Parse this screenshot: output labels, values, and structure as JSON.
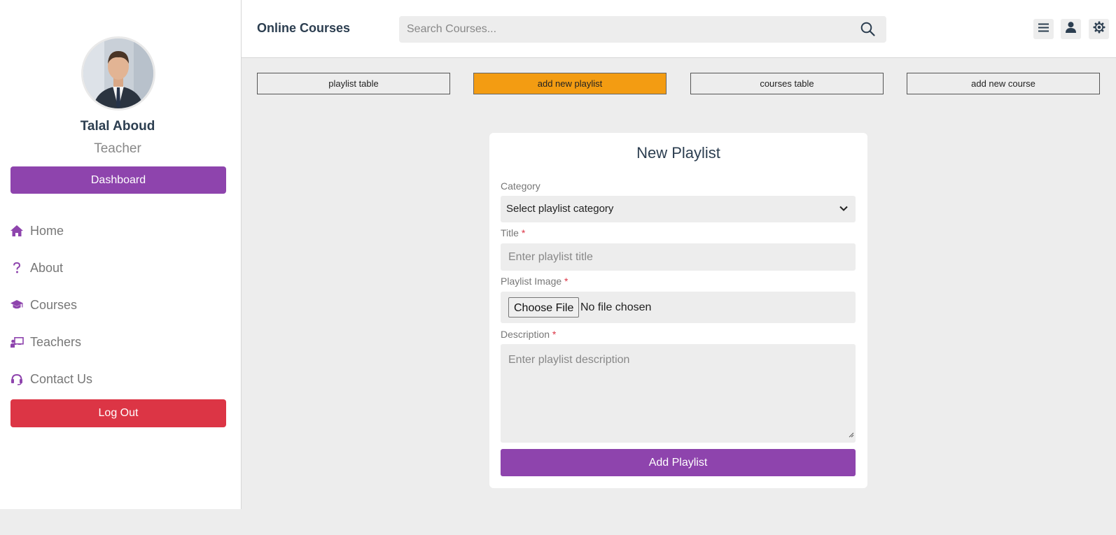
{
  "user": {
    "name": "Talal Aboud",
    "role": "Teacher"
  },
  "sidebar": {
    "dashboard_label": "Dashboard",
    "items": [
      {
        "label": "Home",
        "icon": "home-icon"
      },
      {
        "label": "About",
        "icon": "question-icon"
      },
      {
        "label": "Courses",
        "icon": "graduation-cap-icon"
      },
      {
        "label": "Teachers",
        "icon": "chalkboard-teacher-icon"
      },
      {
        "label": "Contact Us",
        "icon": "headset-icon"
      }
    ],
    "logout_label": "Log Out"
  },
  "header": {
    "brand": "Online Courses",
    "search_placeholder": "Search Courses...",
    "icons": [
      "menu-icon",
      "user-icon",
      "settings-icon"
    ]
  },
  "tabs": [
    {
      "label": "playlist table",
      "active": false
    },
    {
      "label": "add new playlist",
      "active": true
    },
    {
      "label": "courses table",
      "active": false
    },
    {
      "label": "add new course",
      "active": false
    }
  ],
  "form": {
    "title": "New Playlist",
    "category_label": "Category",
    "category_value": "Select playlist category",
    "title_label": "Title",
    "title_placeholder": "Enter playlist title",
    "image_label": "Playlist Image",
    "choose_file_label": "Choose File",
    "no_file_text": "No file chosen",
    "description_label": "Description",
    "description_placeholder": "Enter playlist description",
    "required_mark": "*",
    "submit_label": "Add Playlist"
  },
  "colors": {
    "accent": "#8e44ad",
    "active_tab": "#f39c12",
    "danger": "#dc3545"
  }
}
